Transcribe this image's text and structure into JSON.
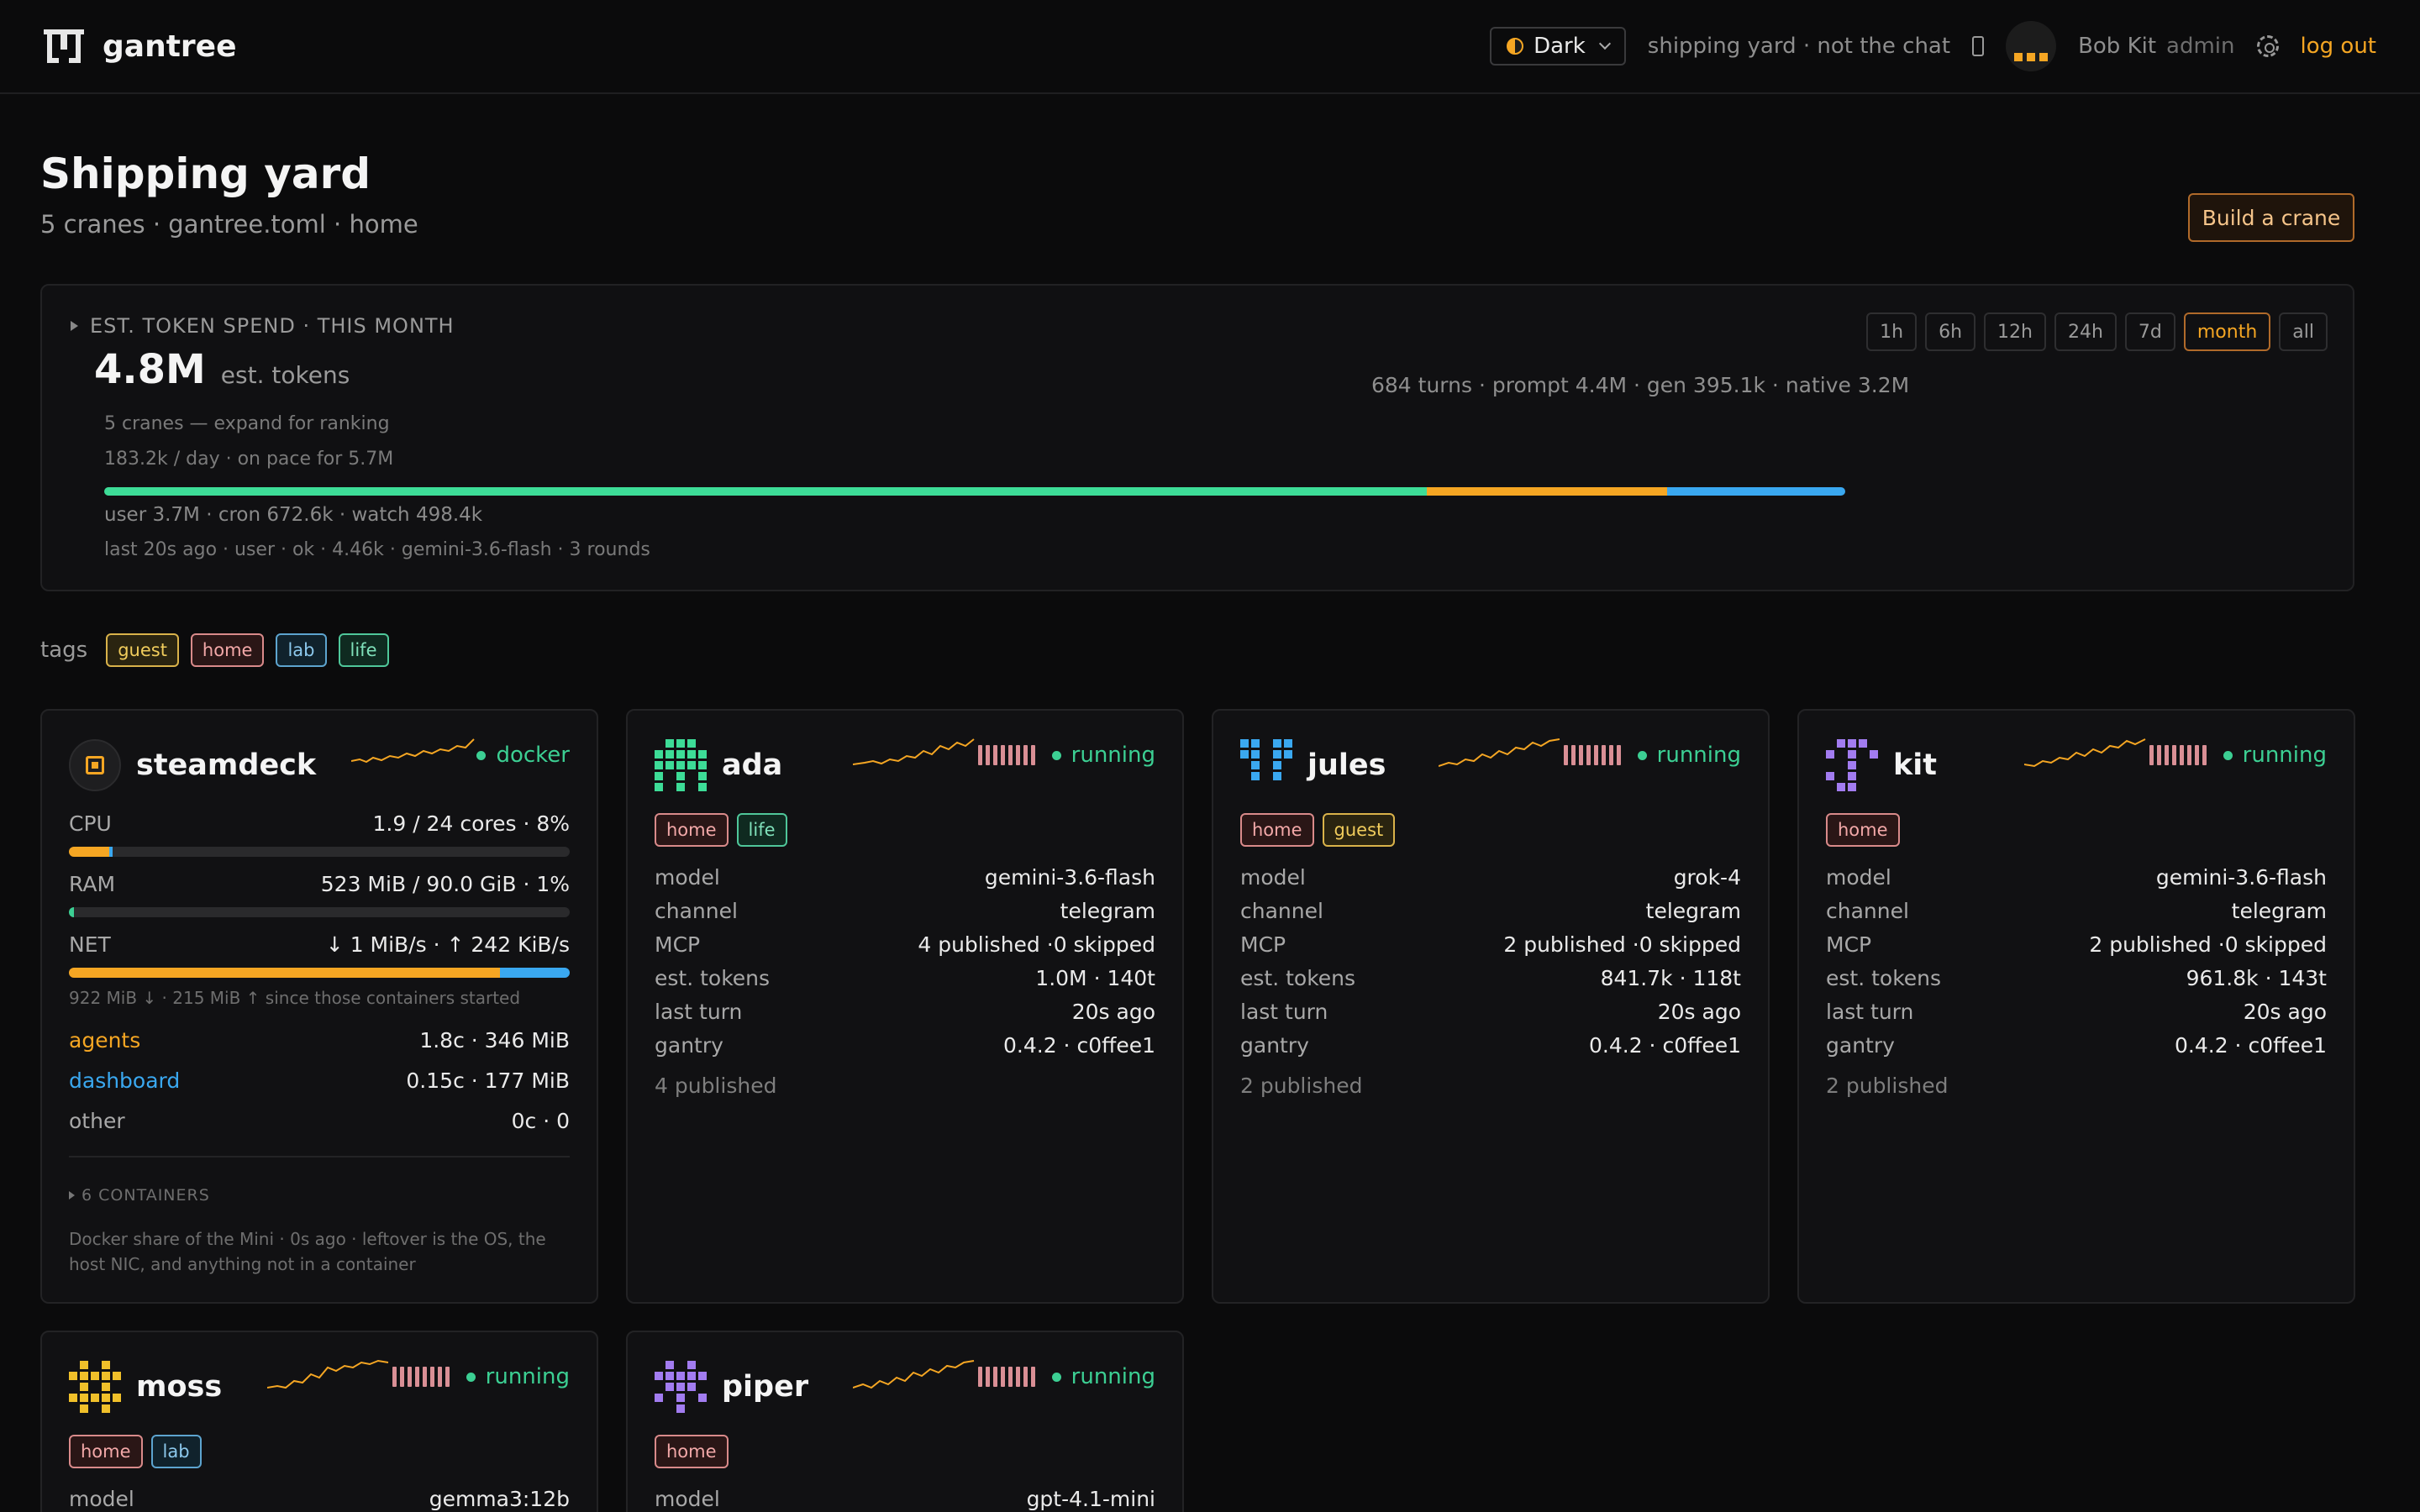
{
  "header": {
    "brand": "gantree",
    "theme_label": "Dark",
    "context": "shipping yard · not the chat",
    "user_name": "Bob Kit",
    "user_role": "admin",
    "logout": "log out"
  },
  "page": {
    "title": "Shipping yard",
    "subtitle": "5 cranes · gantree.toml · home",
    "build_button": "Build a crane"
  },
  "spend": {
    "heading": "EST. TOKEN SPEND · THIS MONTH",
    "total": "4.8M",
    "unit": "est. tokens",
    "summary": "684 turns · prompt 4.4M · gen 395.1k · native 3.2M",
    "ranking_hint": "5 cranes — expand for ranking",
    "pace": "183.2k / day · on pace for 5.7M",
    "breakdown": "user 3.7M · cron 672.6k · watch 498.4k",
    "last": "last 20s ago · user · ok · 4.46k · gemini-3.6-flash · 3 rounds",
    "ranges": [
      "1h",
      "6h",
      "12h",
      "24h",
      "7d",
      "month",
      "all"
    ],
    "active_range": "month",
    "split": [
      {
        "name": "user",
        "value": 3.7,
        "color": "#3ddc97"
      },
      {
        "name": "cron",
        "value": 0.6726,
        "color": "#f5a623"
      },
      {
        "name": "watch",
        "value": 0.4984,
        "color": "#3aa8f0"
      }
    ]
  },
  "tags": {
    "label": "tags",
    "items": [
      "guest",
      "home",
      "lab",
      "life"
    ]
  },
  "steamdeck": {
    "name": "steamdeck",
    "status": "docker",
    "cpu_label": "CPU",
    "cpu_value": "1.9 / 24 cores · 8%",
    "cpu_fill": 0.08,
    "ram_label": "RAM",
    "ram_value": "523 MiB / 90.0 GiB · 1%",
    "ram_fill": 0.01,
    "net_label": "NET",
    "net_value": "↓ 1 MiB/s · ↑ 242 KiB/s",
    "net_down_fill": 0.86,
    "net_up_fill": 0.14,
    "net_note": "922 MiB ↓ · 215 MiB ↑ since those containers started",
    "groups": [
      {
        "name": "agents",
        "value": "1.8c · 346 MiB",
        "color": "#f5a623"
      },
      {
        "name": "dashboard",
        "value": "0.15c · 177 MiB",
        "color": "#3aa8f0"
      },
      {
        "name": "other",
        "value": "0c · 0",
        "color": "#a8a8a8"
      }
    ],
    "containers": "6 CONTAINERS",
    "footnote": "Docker share of the Mini · 0s ago · leftover is the OS, the host NIC, and anything not in a container"
  },
  "cranes": [
    {
      "name": "ada",
      "status": "running",
      "tags": [
        "home",
        "life"
      ],
      "icon_color": "#3ddc97",
      "rows": [
        {
          "k": "model",
          "v": "gemini-3.6-flash"
        },
        {
          "k": "channel",
          "v": "telegram"
        },
        {
          "k": "MCP",
          "v": "4 published ·0 skipped"
        },
        {
          "k": "est. tokens",
          "v": "1.0M · 140t"
        },
        {
          "k": "last turn",
          "v": "20s ago"
        },
        {
          "k": "gantry",
          "v": "0.4.2 · c0ffee1"
        }
      ],
      "published": "4 published"
    },
    {
      "name": "jules",
      "status": "running",
      "tags": [
        "home",
        "guest"
      ],
      "icon_color": "#3aa8f0",
      "rows": [
        {
          "k": "model",
          "v": "grok-4"
        },
        {
          "k": "channel",
          "v": "telegram"
        },
        {
          "k": "MCP",
          "v": "2 published ·0 skipped"
        },
        {
          "k": "est. tokens",
          "v": "841.7k · 118t"
        },
        {
          "k": "last turn",
          "v": "20s ago"
        },
        {
          "k": "gantry",
          "v": "0.4.2 · c0ffee1"
        }
      ],
      "published": "2 published"
    },
    {
      "name": "kit",
      "status": "running",
      "tags": [
        "home"
      ],
      "icon_color": "#a27cf0",
      "rows": [
        {
          "k": "model",
          "v": "gemini-3.6-flash"
        },
        {
          "k": "channel",
          "v": "telegram"
        },
        {
          "k": "MCP",
          "v": "2 published ·0 skipped"
        },
        {
          "k": "est. tokens",
          "v": "961.8k · 143t"
        },
        {
          "k": "last turn",
          "v": "20s ago"
        },
        {
          "k": "gantry",
          "v": "0.4.2 · c0ffee1"
        }
      ],
      "published": "2 published"
    },
    {
      "name": "moss",
      "status": "running",
      "tags": [
        "home",
        "lab"
      ],
      "icon_color": "#f0c02a",
      "rows": [
        {
          "k": "model",
          "v": "gemma3:12b"
        }
      ],
      "published": ""
    },
    {
      "name": "piper",
      "status": "running",
      "tags": [
        "home"
      ],
      "icon_color": "#a27cf0",
      "rows": [
        {
          "k": "model",
          "v": "gpt-4.1-mini"
        }
      ],
      "published": ""
    }
  ],
  "colors": {
    "accent": "#f5a623",
    "running": "#3ccf93",
    "spark": "#f5a623"
  }
}
